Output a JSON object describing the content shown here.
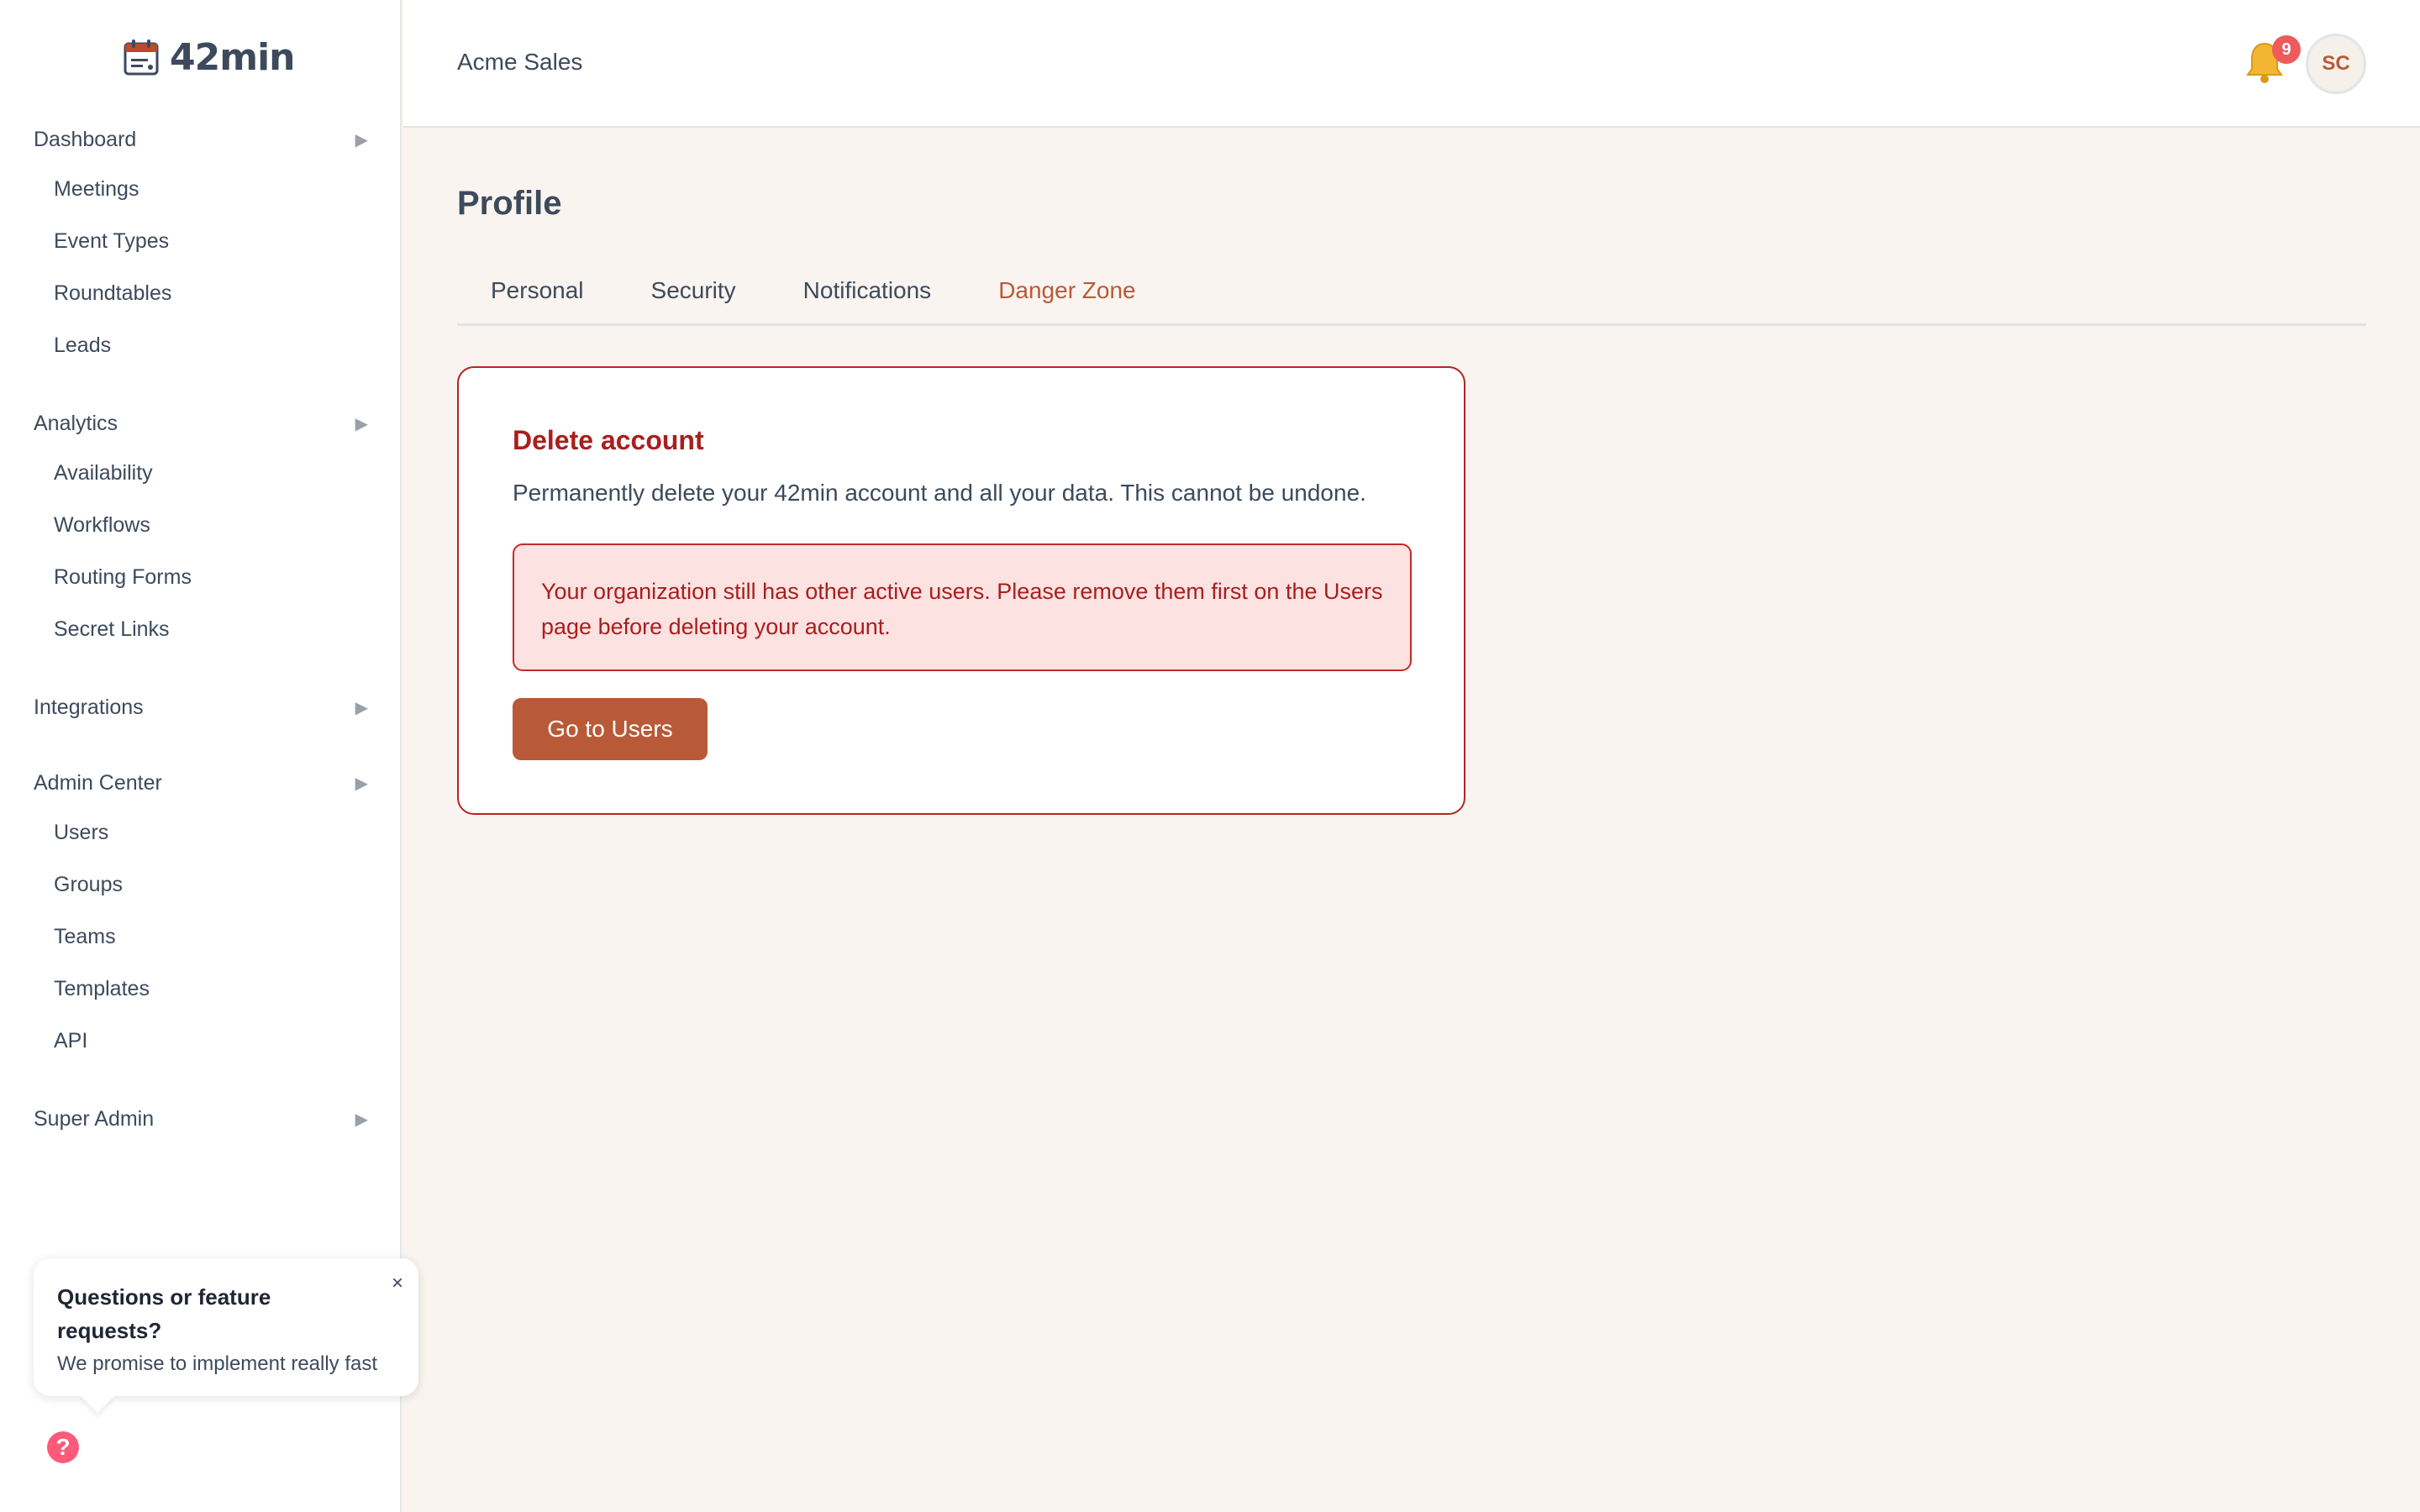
{
  "app": {
    "logo_text": "42min"
  },
  "sidebar": {
    "sections": [
      {
        "label": "Dashboard",
        "items": [
          "Meetings",
          "Event Types",
          "Roundtables",
          "Leads"
        ]
      },
      {
        "label": "Analytics",
        "items": [
          "Availability",
          "Workflows",
          "Routing Forms",
          "Secret Links"
        ]
      },
      {
        "label": "Integrations",
        "items": []
      },
      {
        "label": "Admin Center",
        "items": [
          "Users",
          "Groups",
          "Teams",
          "Templates",
          "API"
        ]
      },
      {
        "label": "Super Admin",
        "items": []
      }
    ]
  },
  "popup": {
    "title": "Questions or feature requests?",
    "body": "We promise to implement really fast",
    "close": "×"
  },
  "help": {
    "icon": "?"
  },
  "header": {
    "org_name": "Acme Sales",
    "notification_count": "9",
    "avatar_initials": "SC"
  },
  "main": {
    "title": "Profile",
    "tabs": [
      {
        "label": "Personal",
        "active": false
      },
      {
        "label": "Security",
        "active": false
      },
      {
        "label": "Notifications",
        "active": false
      },
      {
        "label": "Danger Zone",
        "active": true
      }
    ],
    "card": {
      "title": "Delete account",
      "description": "Permanently delete your 42min account and all your data. This cannot be undone.",
      "alert": "Your organization still has other active users. Please remove them first on the Users page before deleting your account.",
      "button": "Go to Users"
    }
  },
  "colors": {
    "accent": "#b85a37",
    "danger": "#a91e1e",
    "alert_bg": "#fde2e2",
    "page_bg": "#f9f4ef"
  }
}
